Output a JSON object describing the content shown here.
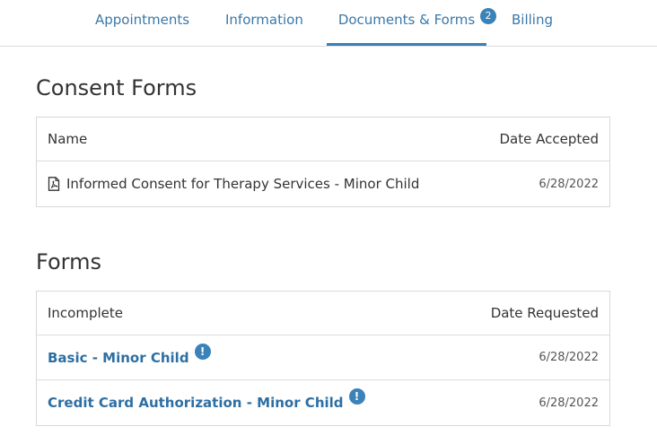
{
  "tabs": [
    {
      "label": "Appointments"
    },
    {
      "label": "Information"
    },
    {
      "label": "Documents & Forms",
      "badge": "2"
    },
    {
      "label": "Billing"
    }
  ],
  "consent": {
    "title": "Consent Forms",
    "header": {
      "name": "Name",
      "date": "Date Accepted"
    },
    "rows": [
      {
        "name": "Informed Consent for Therapy Services - Minor Child",
        "date": "6/28/2022",
        "icon": "pdf-icon"
      }
    ]
  },
  "forms": {
    "title": "Forms",
    "header": {
      "name": "Incomplete",
      "date": "Date Requested"
    },
    "rows": [
      {
        "name": "Basic - Minor Child",
        "date": "6/28/2022",
        "alert": "!"
      },
      {
        "name": "Credit Card Authorization - Minor Child",
        "date": "6/28/2022",
        "alert": "!"
      }
    ]
  },
  "colors": {
    "accent": "#3a82b8",
    "link": "#2e6fa3",
    "tab_text": "#3978a8"
  }
}
